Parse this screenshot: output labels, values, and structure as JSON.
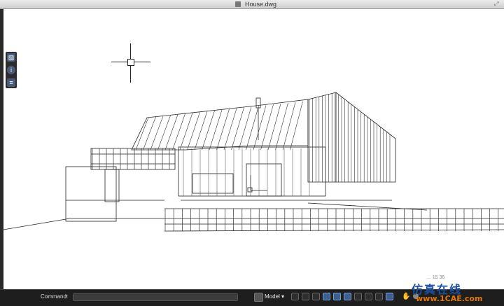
{
  "window": {
    "title": "House.dwg"
  },
  "palette": {
    "buttons": [
      {
        "icon": "properties-icon",
        "glyph": "▨"
      },
      {
        "icon": "info-icon",
        "glyph": "i"
      },
      {
        "icon": "layers-icon",
        "glyph": "≡"
      }
    ]
  },
  "statusbar": {
    "command_label": "Command:",
    "command_value": "",
    "model_label": "Model ▾"
  },
  "watermark": {
    "coords": "...  15  36",
    "logo_text": "仿真在线",
    "url": "www.1CAE.com"
  }
}
